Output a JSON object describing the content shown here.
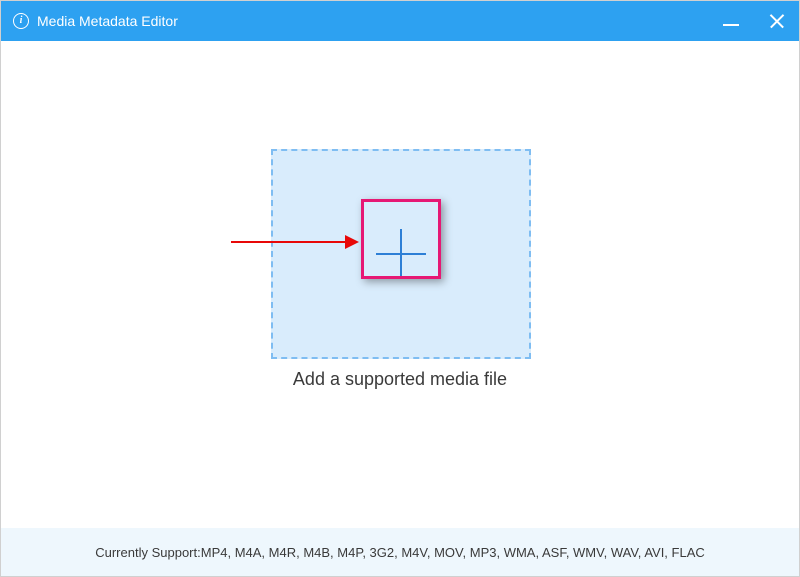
{
  "titlebar": {
    "title": "Media Metadata Editor"
  },
  "main": {
    "prompt": "Add a supported media file"
  },
  "footer": {
    "label": "Currently Support: ",
    "formats": "MP4, M4A, M4R, M4B, M4P, 3G2, M4V, MOV, MP3, WMA, ASF, WMV, WAV, AVI, FLAC"
  }
}
